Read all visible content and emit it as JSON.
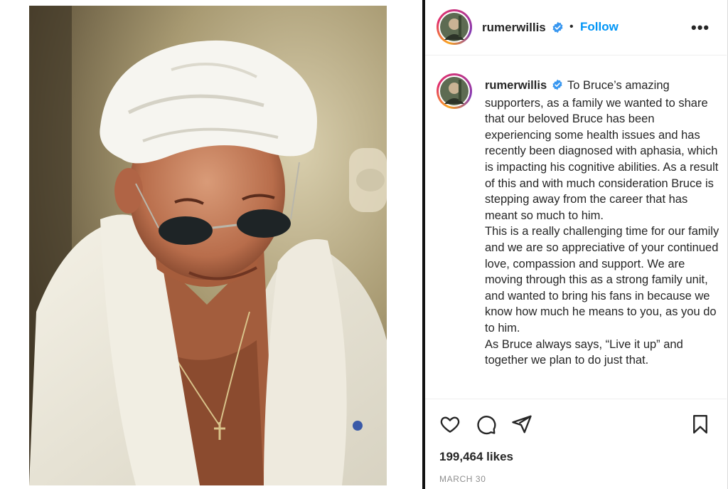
{
  "post": {
    "username": "rumerwillis",
    "follow_label": "Follow",
    "separator": "•",
    "more_label": "•••"
  },
  "caption": {
    "username": "rumerwillis",
    "paragraphs": [
      "To Bruce’s amazing supporters, as a family we wanted to share that our beloved Bruce has been experiencing some health issues and has recently been diagnosed with aphasia, which is impacting his cognitive abilities. As a result of this and with much consideration Bruce is stepping away from the career that has meant so much to him.",
      "This is a really challenging time for our family and we are so appreciative of your continued love, compassion and support. We are moving through this as a strong family unit, and wanted to bring his fans in because we know how much he means to you, as you do to him.",
      "As Bruce always says, “Live it up” and together we plan to do just that."
    ]
  },
  "stats": {
    "likes": "199,464 likes",
    "date": "MARCH 30"
  },
  "icons": {
    "like": "heart-icon",
    "comment": "comment-icon",
    "share": "share-icon",
    "save": "bookmark-icon",
    "verified": "verified-badge-icon",
    "more": "more-options-icon"
  },
  "colors": {
    "accent": "#0095f6",
    "verified": "#3897f0",
    "text": "#262626",
    "muted": "#8e8e8e"
  }
}
